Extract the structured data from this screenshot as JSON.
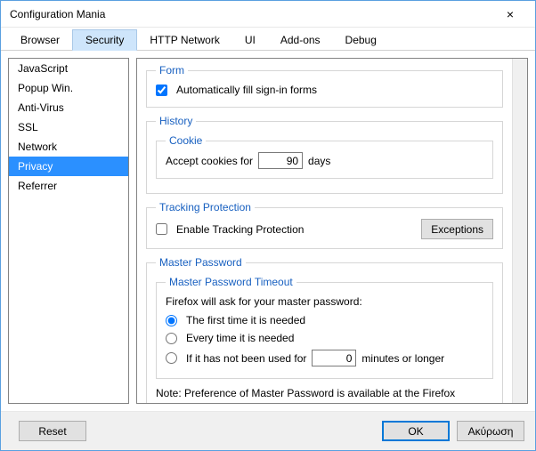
{
  "window": {
    "title": "Configuration Mania",
    "close_label": "×"
  },
  "tabs": {
    "items": [
      "Browser",
      "Security",
      "HTTP Network",
      "UI",
      "Add-ons",
      "Debug"
    ],
    "active_index": 1
  },
  "sidebar": {
    "items": [
      "JavaScript",
      "Popup Win.",
      "Anti-Virus",
      "SSL",
      "Network",
      "Privacy",
      "Referrer"
    ],
    "selected_index": 5
  },
  "form_group": {
    "legend": "Form",
    "auto_fill": {
      "label": "Automatically fill sign-in forms",
      "checked": true
    }
  },
  "history_group": {
    "legend": "History",
    "cookie_group": {
      "legend": "Cookie",
      "accept_prefix": "Accept cookies for",
      "accept_value": "90",
      "accept_suffix": "days"
    }
  },
  "tracking_group": {
    "legend": "Tracking Protection",
    "enable": {
      "label": "Enable Tracking Protection",
      "checked": false
    },
    "exceptions_btn": "Exceptions"
  },
  "master_group": {
    "legend": "Master Password",
    "timeout_group": {
      "legend": "Master Password Timeout",
      "intro": "Firefox will ask for your master password:",
      "opts": [
        {
          "label": "The first time it is needed"
        },
        {
          "label": "Every time it is needed"
        },
        {
          "prefix": "If it has not been used for",
          "value": "0",
          "suffix": "minutes or longer"
        }
      ],
      "selected_index": 0
    },
    "note": "Note: Preference of Master Password is available at the Firefox Preference panel."
  },
  "footer": {
    "reset": "Reset",
    "ok": "OK",
    "cancel": "Ακύρωση"
  }
}
